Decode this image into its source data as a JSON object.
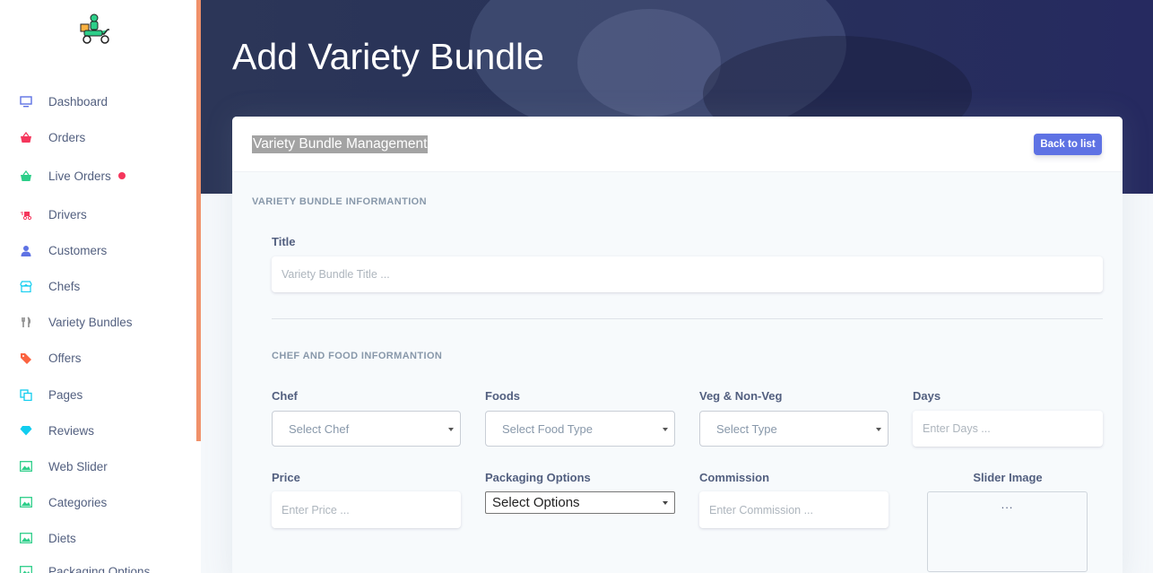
{
  "sidebar": {
    "items": [
      {
        "label": "Dashboard",
        "icon": "monitor-icon",
        "color": "#5e72e4"
      },
      {
        "label": "Orders",
        "icon": "basket-icon",
        "color": "#f5365c"
      },
      {
        "label": "Live Orders",
        "icon": "basket-icon",
        "color": "#2dce89"
      },
      {
        "label": "Drivers",
        "icon": "delivery-icon",
        "color": "#f5365c"
      },
      {
        "label": "Customers",
        "icon": "user-icon",
        "color": "#5e72e4"
      },
      {
        "label": "Chefs",
        "icon": "store-icon",
        "color": "#11cdef"
      },
      {
        "label": "Variety Bundles",
        "icon": "utensils-icon",
        "color": "#8c8c8c"
      },
      {
        "label": "Offers",
        "icon": "tags-icon",
        "color": "#fb6340"
      },
      {
        "label": "Pages",
        "icon": "copy-icon",
        "color": "#11cdef"
      },
      {
        "label": "Reviews",
        "icon": "diamond-icon",
        "color": "#11cdef"
      },
      {
        "label": "Web Slider",
        "icon": "image-icon",
        "color": "#2dce89"
      },
      {
        "label": "Categories",
        "icon": "image-icon",
        "color": "#2dce89"
      },
      {
        "label": "Diets",
        "icon": "image-icon",
        "color": "#2dce89"
      },
      {
        "label": "Packaging Options",
        "icon": "image-icon",
        "color": "#2dce89"
      }
    ]
  },
  "header": {
    "title": "Add Variety Bundle"
  },
  "card": {
    "title": "Variety Bundle Management",
    "back_button": "Back to list",
    "section_info": "VARIETY BUNDLE INFORMANTION",
    "section_chef": "CHEF AND FOOD INFORMANTION"
  },
  "form": {
    "title_label": "Title",
    "title_placeholder": "Variety Bundle Title ...",
    "chef_label": "Chef",
    "chef_select": "Select Chef",
    "foods_label": "Foods",
    "foods_select": "Select Food Type",
    "veg_label": "Veg & Non-Veg",
    "veg_select": "Select Type",
    "days_label": "Days",
    "days_placeholder": "Enter Days ...",
    "price_label": "Price",
    "price_placeholder": "Enter Price ...",
    "packaging_label": "Packaging Options",
    "packaging_select": "Select Options",
    "commission_label": "Commission",
    "commission_placeholder": "Enter Commission ...",
    "slider_image_label": "Slider Image",
    "slider_image_value": "..."
  }
}
